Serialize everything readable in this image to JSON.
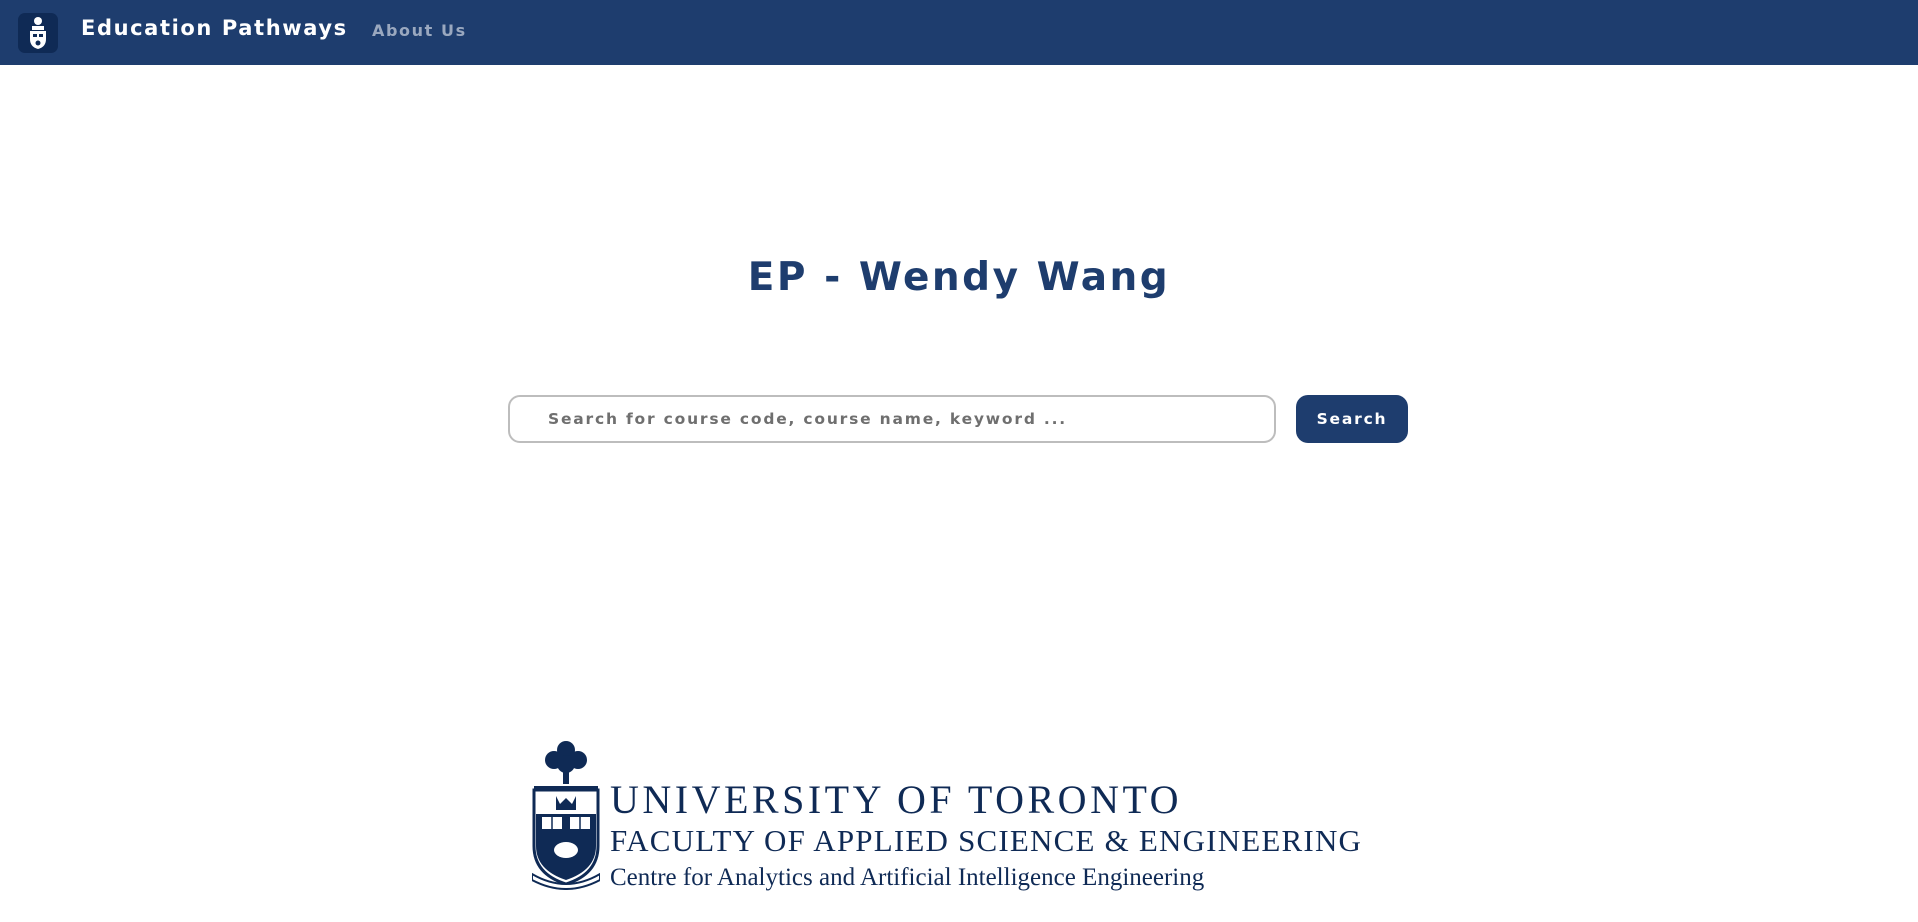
{
  "navbar": {
    "logo_icon": "university-crest-icon",
    "brand": "Education Pathways",
    "links": [
      {
        "label": "About Us"
      }
    ]
  },
  "main": {
    "title": "EP - Wendy Wang",
    "search": {
      "placeholder": "Search for course code, course name, keyword ...",
      "value": "",
      "button_label": "Search"
    }
  },
  "footer": {
    "logo": {
      "crest_icon": "university-crest-icon",
      "line1": "UNIVERSITY OF TORONTO",
      "line2": "FACULTY OF APPLIED SCIENCE & ENGINEERING",
      "line3": "Centre for Analytics and Artificial Intelligence Engineering"
    }
  },
  "colors": {
    "navbar_bg": "#1e3d6e",
    "accent": "#1e3d6e",
    "nav_link": "#9aa8bf",
    "logo_text": "#0f2a55"
  }
}
